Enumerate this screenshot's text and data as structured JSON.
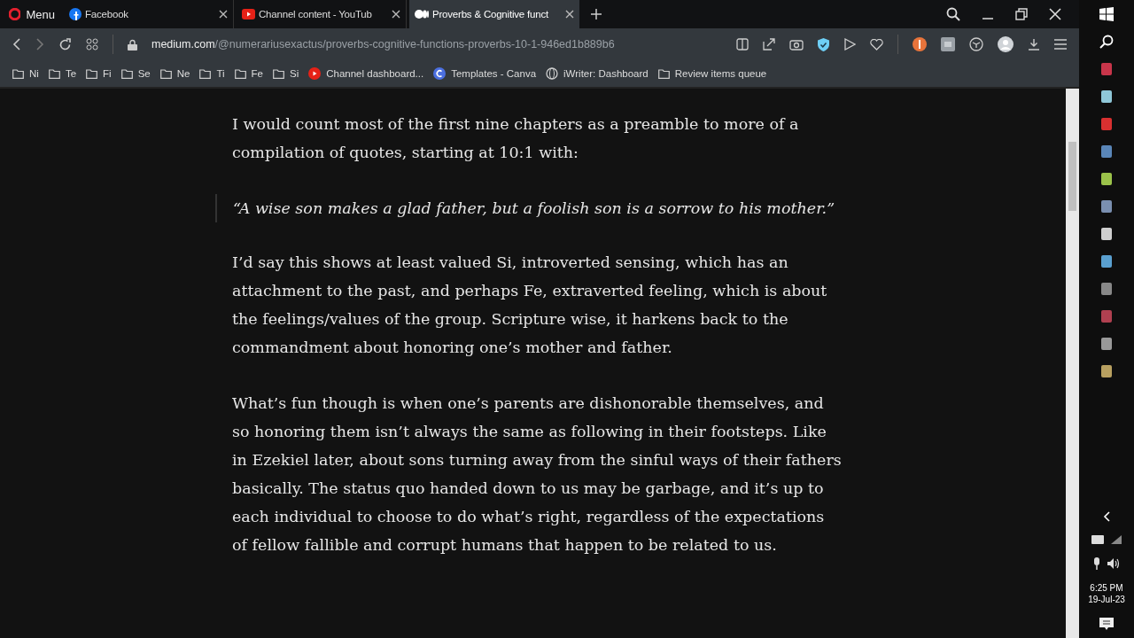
{
  "browser": {
    "menu_label": "Menu",
    "tabs": [
      {
        "title": "Facebook",
        "kind": "facebook",
        "selected": false
      },
      {
        "title": "Channel content - YouTub",
        "kind": "youtube",
        "selected": false
      },
      {
        "title": "Proverbs & Cognitive funct",
        "kind": "medium",
        "selected": true
      }
    ],
    "address": {
      "domain": "medium.com",
      "path": "/@numerariusexactus/proverbs-cognitive-functions-proverbs-10-1-946ed1b889b6"
    },
    "bookmarks": [
      {
        "label": "Ni",
        "kind": "folder"
      },
      {
        "label": "Te",
        "kind": "folder"
      },
      {
        "label": "Fi",
        "kind": "folder"
      },
      {
        "label": "Se",
        "kind": "folder"
      },
      {
        "label": "Ne",
        "kind": "folder"
      },
      {
        "label": "Ti",
        "kind": "folder"
      },
      {
        "label": "Fe",
        "kind": "folder"
      },
      {
        "label": "Si",
        "kind": "folder"
      },
      {
        "label": "Channel dashboard...",
        "kind": "youtube"
      },
      {
        "label": "Templates - Canva",
        "kind": "canva"
      },
      {
        "label": "iWriter: Dashboard",
        "kind": "iwriter"
      },
      {
        "label": "Review items queue",
        "kind": "folder"
      }
    ]
  },
  "article": [
    {
      "kind": "paragraph",
      "text": "I would count most of the first nine chapters as a preamble to more of a compilation of quotes, starting at 10:1 with:"
    },
    {
      "kind": "quote",
      "text": "“A wise son makes a glad father, but a foolish son is a sorrow to his mother.”"
    },
    {
      "kind": "paragraph",
      "text": "I’d say this shows at least valued Si, introverted sensing, which has an attachment to the past, and perhaps Fe, extraverted feeling, which is about the feelings/values of the group. Scripture wise, it harkens back to the commandment about honoring one’s mother and father."
    },
    {
      "kind": "paragraph",
      "text": "What’s fun though is when one’s parents are dishonorable themselves, and so honoring them isn’t always the same as following in their footsteps. Like in Ezekiel later, about sons turning away from the sinful ways of their fathers basically. The status quo handed down to us may be garbage, and it’s up to each individual to choose to do what’s right, regardless of the expectations of fellow fallible and corrupt humans that happen to be related to us."
    }
  ],
  "taskbar": {
    "time": "6:25 PM",
    "date": "19-Jul-23"
  }
}
